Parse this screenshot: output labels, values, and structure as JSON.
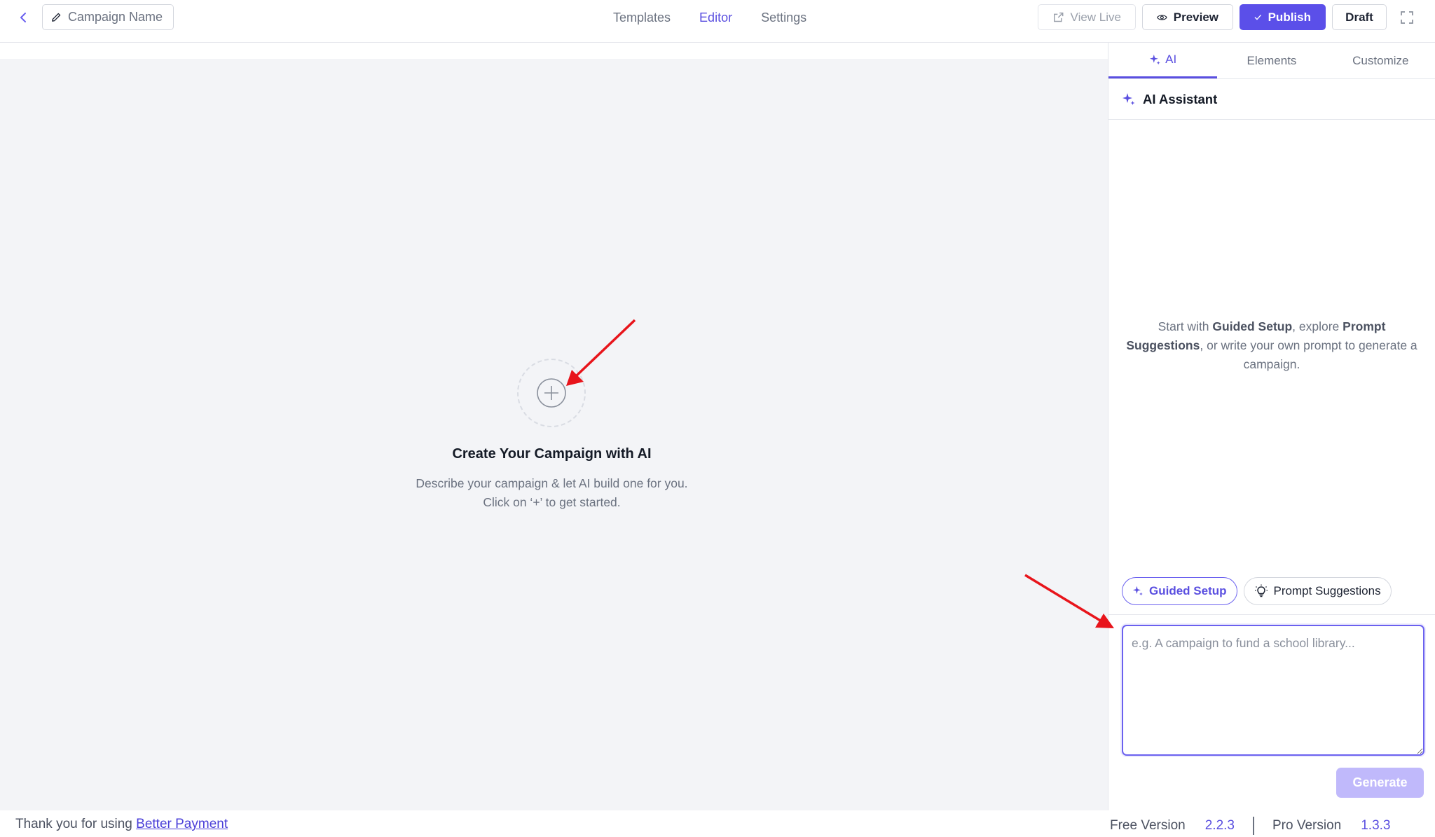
{
  "header": {
    "campaign_name": "Campaign Name",
    "tabs": [
      {
        "label": "Templates",
        "active": false
      },
      {
        "label": "Editor",
        "active": true
      },
      {
        "label": "Settings",
        "active": false
      }
    ],
    "actions": {
      "view_live": "View Live",
      "preview": "Preview",
      "publish": "Publish",
      "draft": "Draft"
    }
  },
  "canvas": {
    "title": "Create Your Campaign with AI",
    "description_line1": "Describe your campaign & let AI build one for you.",
    "description_line2": "Click on ‘+’ to get started."
  },
  "panel": {
    "tabs": [
      {
        "label": "AI",
        "active": true
      },
      {
        "label": "Elements",
        "active": false
      },
      {
        "label": "Customize",
        "active": false
      }
    ],
    "assistant_title": "AI Assistant",
    "intro": {
      "prefix": "Start with ",
      "guided": "Guided Setup",
      "mid": ", explore ",
      "prompt": "Prompt Suggestions",
      "suffix": ", or write your own prompt to generate a campaign."
    },
    "chips": {
      "guided_setup": "Guided Setup",
      "prompt_suggestions": "Prompt Suggestions"
    },
    "prompt_placeholder": "e.g. A campaign to fund a school library...",
    "generate_label": "Generate"
  },
  "footer": {
    "thanks_text": "Thank you for using ",
    "brand_link": "Better Payment",
    "free_label": "Free Version",
    "free_version": "2.2.3",
    "pro_label": "Pro Version",
    "pro_version": "1.3.3"
  },
  "colors": {
    "accent": "#5b4fe9",
    "canvas_bg": "#f3f4f7",
    "annotation_arrow": "#e8141b"
  }
}
